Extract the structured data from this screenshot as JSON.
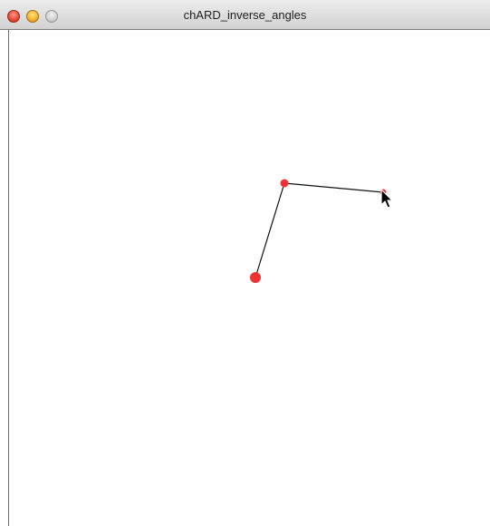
{
  "window": {
    "title": "chARD_inverse_angles"
  },
  "icons": {
    "close": "close-button-icon",
    "minimize": "minimize-button-icon",
    "zoom": "zoom-button-icon",
    "cursor": "arrow-cursor-icon"
  },
  "colors": {
    "joint": "#ee3333",
    "segment": "#111111",
    "canvas_background": "#ffffff"
  }
}
